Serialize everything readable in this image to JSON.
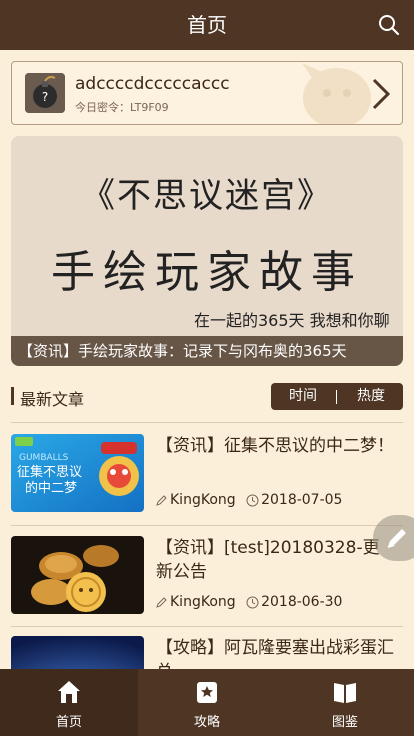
{
  "header": {
    "title": "首页",
    "search_icon": "search-icon"
  },
  "code_card": {
    "code": "adccccdcccccaccc",
    "password_label": "今日密令：LT9F09",
    "icon": "bomb-icon"
  },
  "banner": {
    "line1": "《不思议迷宫》",
    "line2": "手绘玩家故事",
    "line3": "在一起的365天  我想和你聊",
    "caption": "【资讯】手绘玩家故事：记录下与冈布奥的365天"
  },
  "section": {
    "title": "最新文章",
    "sort_time": "时间",
    "sort_hot": "热度"
  },
  "articles": [
    {
      "title": "【资讯】征集不思议的中二梦！",
      "author": "KingKong",
      "date": "2018-07-05",
      "thumb_tag": "GUMBALLS",
      "thumb_text1": "征集不思议",
      "thumb_text2": "的中二梦"
    },
    {
      "title": "【资讯】[test]20180328-更新公告",
      "author": "KingKong",
      "date": "2018-06-30"
    },
    {
      "title": "【攻略】阿瓦隆要塞出战彩蛋汇总",
      "author": "",
      "date": ""
    }
  ],
  "tabbar": [
    {
      "label": "首页",
      "icon": "home-icon"
    },
    {
      "label": "攻略",
      "icon": "guide-icon"
    },
    {
      "label": "图鉴",
      "icon": "book-icon"
    }
  ],
  "colors": {
    "header": "#4e3524",
    "background": "#fbefd9",
    "text": "#3b2718"
  }
}
